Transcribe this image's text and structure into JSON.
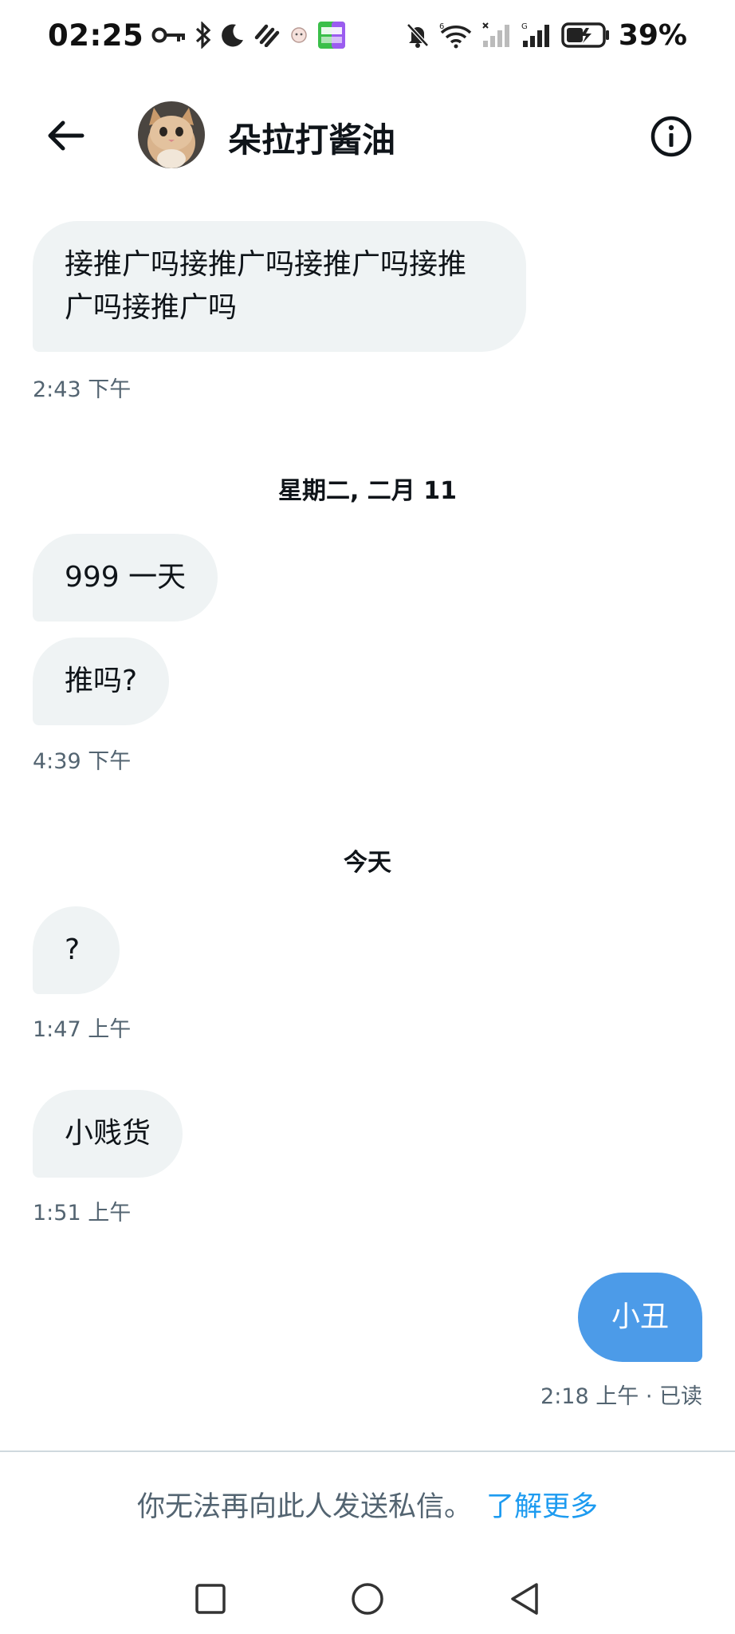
{
  "status_bar": {
    "time": "02:25",
    "battery_percent": "39%",
    "icons_left": [
      "key-icon",
      "bluetooth-icon",
      "moon-icon",
      "app-notification-icon",
      "ghost-icon",
      "iqiyi-app-icon"
    ],
    "icons_right": [
      "bell-muted-icon",
      "wifi-icon",
      "signal-icon",
      "signal-icon",
      "battery-icon"
    ]
  },
  "header": {
    "contact_name": "朵拉打酱油"
  },
  "messages": [
    {
      "direction": "in",
      "text": "接推广吗接推广吗接推广吗接推广吗接推广吗"
    },
    {
      "timestamp": "2:43 下午"
    },
    {
      "date_separator": "星期二, 二月 11"
    },
    {
      "direction": "in",
      "text": "999 一天"
    },
    {
      "direction": "in",
      "text": "推吗?"
    },
    {
      "timestamp": "4:39 下午"
    },
    {
      "date_separator": "今天"
    },
    {
      "direction": "in",
      "text": "?"
    },
    {
      "timestamp": "1:47 上午"
    },
    {
      "direction": "in",
      "text": "小贱货"
    },
    {
      "timestamp": "1:51 上午"
    },
    {
      "direction": "out",
      "text": "小丑"
    },
    {
      "timestamp": "2:18 上午 · 已读"
    }
  ],
  "footer": {
    "notice": "你无法再向此人发送私信。",
    "learn_more": "了解更多"
  },
  "colors": {
    "incoming_bubble": "#eff3f4",
    "outgoing_bubble": "#4c9be8",
    "link": "#1d9bf0",
    "secondary_text": "#536471"
  }
}
